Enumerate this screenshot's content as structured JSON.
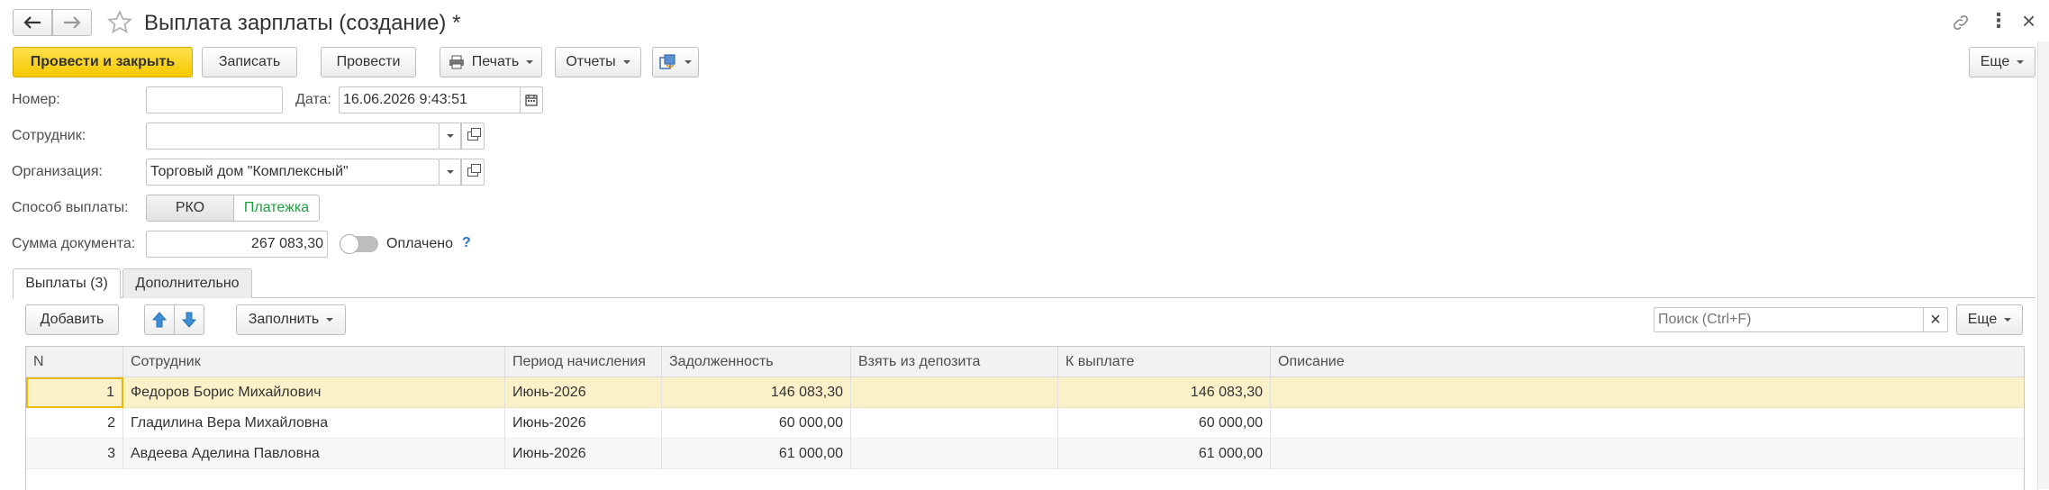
{
  "window": {
    "title": "Выплата зарплаты (создание) *",
    "more_glyph": "⋮",
    "close_glyph": "×"
  },
  "toolbar": {
    "post_and_close": "Провести и закрыть",
    "save": "Записать",
    "post": "Провести",
    "print": "Печать",
    "reports": "Отчеты",
    "more": "Еще"
  },
  "form": {
    "number_label": "Номер:",
    "number_value": "",
    "date_label": "Дата:",
    "date_value": "16.06.2026  9:43:51",
    "employee_label": "Сотрудник:",
    "employee_value": "",
    "organization_label": "Организация:",
    "organization_value": "Торговый дом \"Комплексный\"",
    "payment_method_label": "Способ выплаты:",
    "payment_methods": [
      "РКО",
      "Платежка"
    ],
    "payment_method_selected": "Платежка",
    "sum_label": "Сумма документа:",
    "sum_value": "267 083,30",
    "paid_label": "Оплачено",
    "paid_help": "?",
    "paid_on": false
  },
  "tabs": [
    {
      "label": "Выплаты (3)",
      "active": true
    },
    {
      "label": "Дополнительно",
      "active": false
    }
  ],
  "table_toolbar": {
    "add": "Добавить",
    "fill": "Заполнить",
    "search_placeholder": "Поиск (Ctrl+F)",
    "clear_glyph": "×",
    "more": "Еще"
  },
  "table": {
    "columns": [
      "N",
      "Сотрудник",
      "Период начисления",
      "Задолженность",
      "Взять из депозита",
      "К выплате",
      "Описание"
    ],
    "rows": [
      {
        "n": "1",
        "employee": "Федоров Борис Михайлович",
        "period": "Июнь-2026",
        "debt": "146 083,30",
        "deposit": "",
        "payout": "146 083,30",
        "description": ""
      },
      {
        "n": "2",
        "employee": "Гладилина Вера Михайловна",
        "period": "Июнь-2026",
        "debt": "60 000,00",
        "deposit": "",
        "payout": "60 000,00",
        "description": ""
      },
      {
        "n": "3",
        "employee": "Авдеева Аделина Павловна",
        "period": "Июнь-2026",
        "debt": "61 000,00",
        "deposit": "",
        "payout": "61 000,00",
        "description": ""
      }
    ],
    "selected_row": 0
  },
  "colors": {
    "accent_yellow": "#f5c800",
    "selected_row": "#fbf1c8",
    "selected_cell_border": "#e8b800",
    "active_segment_text": "#1e9e3e",
    "arrow_blue": "#3b8fd6",
    "help_blue": "#2a73c8"
  }
}
